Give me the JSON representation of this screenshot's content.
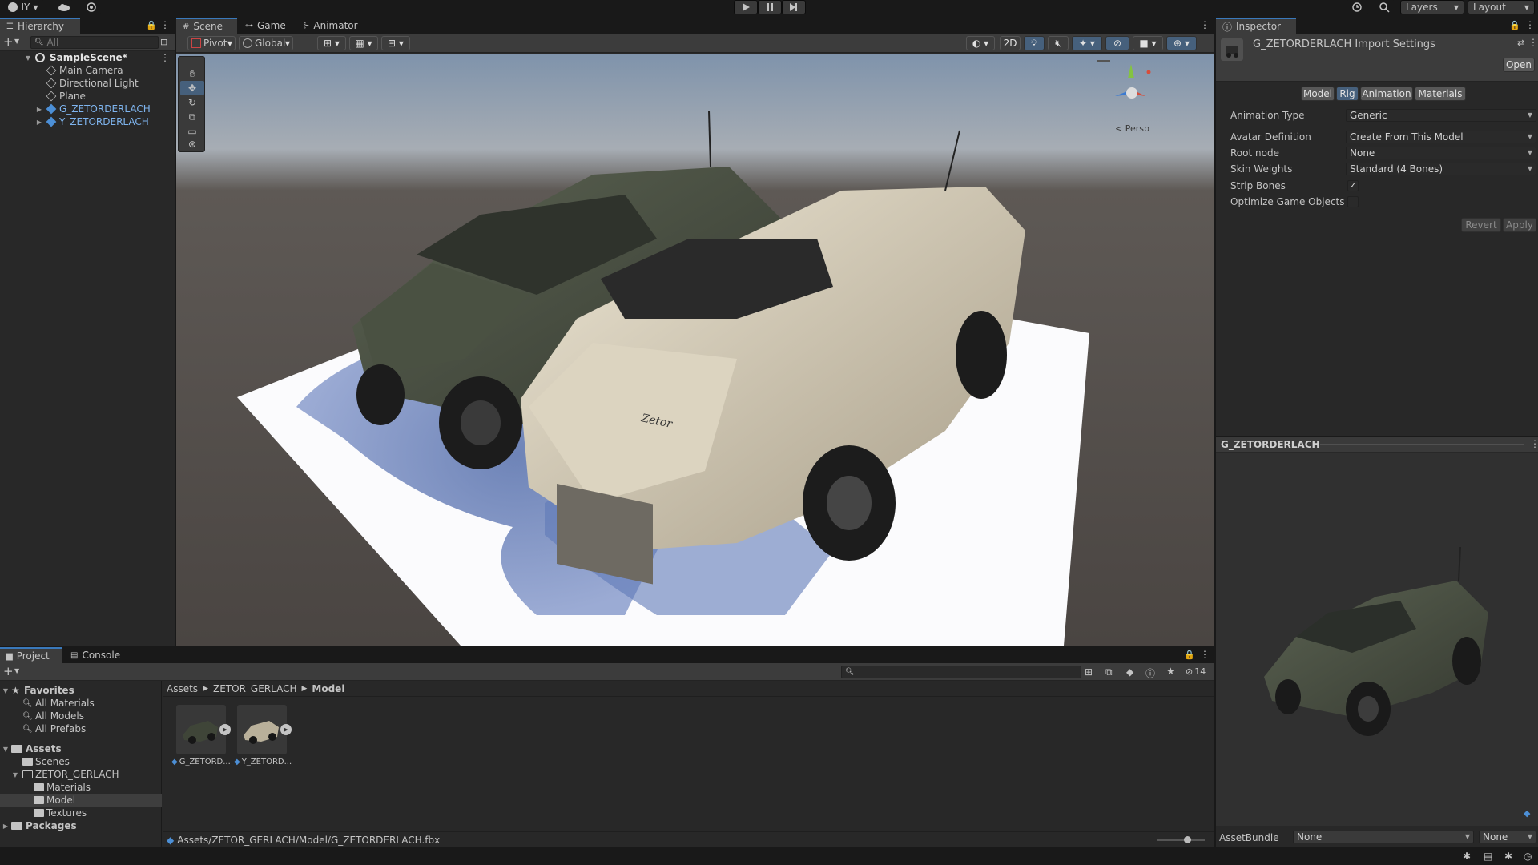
{
  "topbar": {
    "account": "IY",
    "layers": "Layers",
    "layout": "Layout"
  },
  "hierarchy": {
    "tab": "Hierarchy",
    "search_placeholder": "All",
    "scene": "SampleScene*",
    "items": [
      "Main Camera",
      "Directional Light",
      "Plane",
      "G_ZETORDERLACH",
      "Y_ZETORDERLACH"
    ]
  },
  "scene_view": {
    "tabs": [
      "Scene",
      "Game",
      "Animator"
    ],
    "pivot": "Pivot",
    "global": "Global",
    "mode_2d": "2D",
    "persp": "< Persp"
  },
  "inspector": {
    "tab": "Inspector",
    "title": "G_ZETORDERLACH Import Settings",
    "open": "Open",
    "tabs": [
      "Model",
      "Rig",
      "Animation",
      "Materials"
    ],
    "active_tab": "Rig",
    "fields": [
      {
        "label": "Animation Type",
        "value": "Generic"
      },
      {
        "label": "Avatar Definition",
        "value": "Create From This Model"
      },
      {
        "label": "Root node",
        "value": "None"
      },
      {
        "label": "Skin Weights",
        "value": "Standard (4 Bones)"
      }
    ],
    "strip_bones": {
      "label": "Strip Bones",
      "checked": true
    },
    "optimize": {
      "label": "Optimize Game Objects",
      "checked": false
    },
    "revert": "Revert",
    "apply": "Apply",
    "preview_title": "G_ZETORDERLACH",
    "assetbundle_label": "AssetBundle",
    "assetbundle_value": "None",
    "variant_value": "None"
  },
  "project": {
    "tabs": [
      "Project",
      "Console"
    ],
    "favorites": "Favorites",
    "fav_items": [
      "All Materials",
      "All Models",
      "All Prefabs"
    ],
    "assets": "Assets",
    "asset_tree": [
      "Scenes",
      "ZETOR_GERLACH",
      "Materials",
      "Model",
      "Textures"
    ],
    "packages": "Packages",
    "breadcrumb": [
      "Assets",
      "ZETOR_GERLACH",
      "Model"
    ],
    "hidden_count": "14",
    "files": [
      "G_ZETORD...",
      "Y_ZETORD..."
    ],
    "path": "Assets/ZETOR_GERLACH/Model/G_ZETORDERLACH.fbx"
  },
  "colors": {
    "accent": "#3a79bb",
    "selection": "#2c5d87",
    "scene_sky": "#8d9db0",
    "ground": "#514b47",
    "olive_vehicle": "#4a5142",
    "tan_vehicle": "#cbc2ad"
  }
}
